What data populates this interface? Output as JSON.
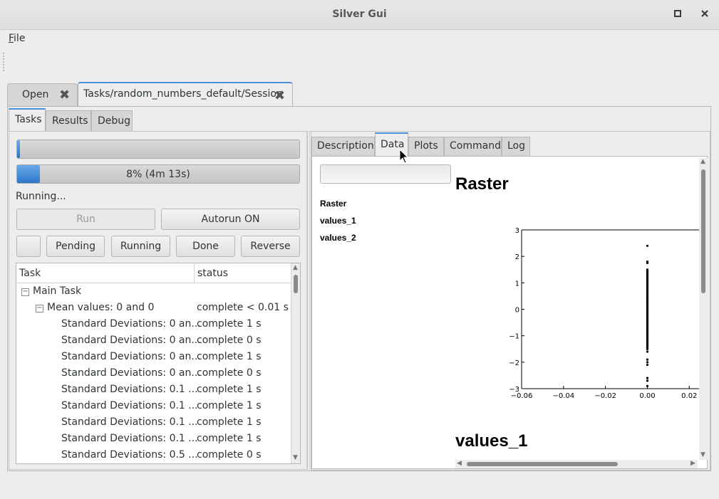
{
  "window": {
    "title": "Silver Gui"
  },
  "menu": {
    "file_prefix": "F",
    "file_rest": "ile"
  },
  "outer_tabs": [
    {
      "label": "Open"
    },
    {
      "label": "Tasks/random_numbers_default/Session"
    }
  ],
  "left_tabs": [
    {
      "label": "Tasks"
    },
    {
      "label": "Results"
    },
    {
      "label": "Debug"
    }
  ],
  "progress_top": {
    "fraction": 0.01
  },
  "progress_main": {
    "label": "8% (4m 13s)",
    "fraction": 0.08
  },
  "status_text": "Running...",
  "buttons": {
    "run": "Run",
    "autorun": "Autorun ON",
    "pending": "Pending",
    "running": "Running",
    "done": "Done",
    "reverse": "Reverse"
  },
  "tree": {
    "columns": {
      "task": "Task",
      "status": "status"
    },
    "root": {
      "label": "Main Task",
      "expander": "−"
    },
    "child": {
      "label": "Mean values: 0 and 0",
      "status": "complete < 0.01 s",
      "expander": "−"
    },
    "rows": [
      {
        "label": "Standard Deviations: 0 an...",
        "status": "complete 1 s"
      },
      {
        "label": "Standard Deviations: 0 an...",
        "status": "complete 0 s"
      },
      {
        "label": "Standard Deviations: 0 an...",
        "status": "complete 1 s"
      },
      {
        "label": "Standard Deviations: 0 an...",
        "status": "complete 0 s"
      },
      {
        "label": "Standard Deviations: 0.1 ...",
        "status": "complete 1 s"
      },
      {
        "label": "Standard Deviations: 0.1 ...",
        "status": "complete 1 s"
      },
      {
        "label": "Standard Deviations: 0.1 ...",
        "status": "complete 1 s"
      },
      {
        "label": "Standard Deviations: 0.1 ...",
        "status": "complete 1 s"
      },
      {
        "label": "Standard Deviations: 0.5 ...",
        "status": "complete 0 s"
      }
    ]
  },
  "right_tabs": [
    {
      "label": "Description"
    },
    {
      "label": "Data"
    },
    {
      "label": "Plots"
    },
    {
      "label": "Command"
    },
    {
      "label": "Log"
    }
  ],
  "data_view": {
    "links": [
      "Raster",
      "values_1",
      "values_2"
    ],
    "heading_1": "Raster",
    "heading_2": "values_1"
  },
  "chart_data": {
    "type": "scatter",
    "title": "",
    "xlabel": "",
    "ylabel": "",
    "xlim": [
      -0.06,
      0.025
    ],
    "ylim": [
      -3,
      3
    ],
    "x_ticks": [
      "−0.06",
      "−0.04",
      "−0.02",
      "0.00",
      "0.02"
    ],
    "y_ticks": [
      "3",
      "2",
      "1",
      "0",
      "−1",
      "−2",
      "−3"
    ],
    "points_x": 0.0,
    "points_y": [
      2.4,
      1.8,
      1.75,
      1.5,
      1.4,
      1.3,
      1.2,
      1.1,
      1.0,
      0.9,
      0.8,
      0.7,
      0.6,
      0.5,
      0.4,
      0.3,
      0.2,
      0.1,
      0.0,
      -0.1,
      -0.2,
      -0.3,
      -0.4,
      -0.5,
      -0.6,
      -0.7,
      -0.8,
      -0.9,
      -1.0,
      -1.1,
      -1.2,
      -1.3,
      -1.4,
      -1.5,
      -1.6,
      -1.9,
      -2.0,
      -2.1,
      -2.6,
      -2.7,
      -2.9
    ],
    "grid": false,
    "point_color": "#000000"
  },
  "colors": {
    "accent": "#4a90d9",
    "progress": "#3a86d6"
  }
}
